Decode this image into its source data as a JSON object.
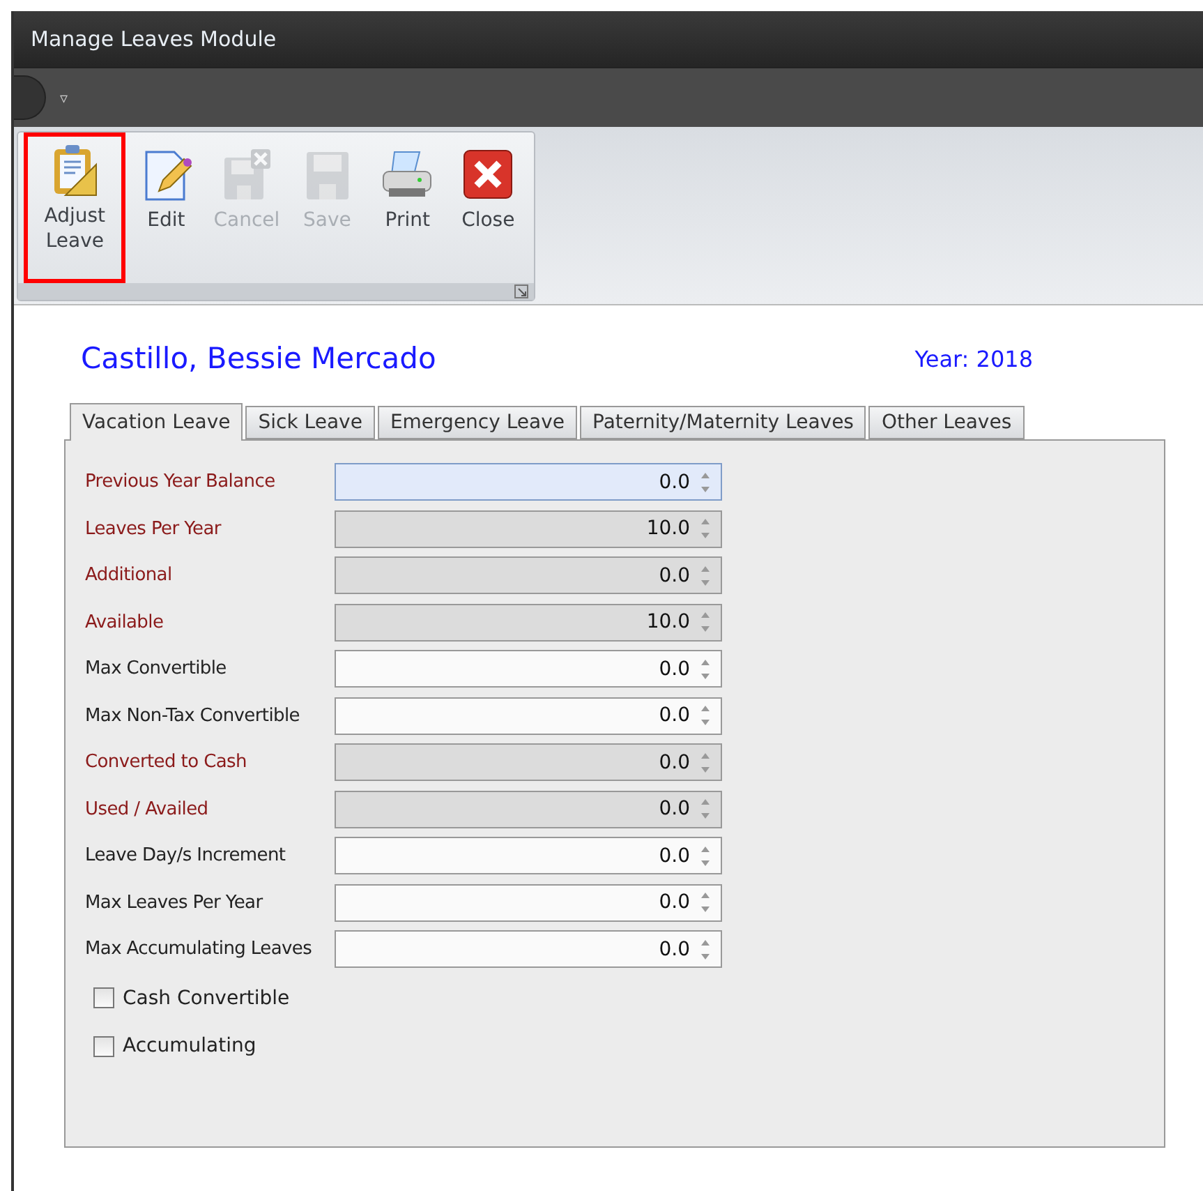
{
  "window": {
    "title": "Manage Leaves Module",
    "menu_glyph": "▿"
  },
  "toolbar": [
    {
      "label": "Adjust\nLeave",
      "kind": "adjust",
      "disabled": false,
      "highlighted": true
    },
    {
      "label": "Edit",
      "kind": "edit",
      "disabled": false,
      "highlighted": false
    },
    {
      "label": "Cancel",
      "kind": "cancel",
      "disabled": true,
      "highlighted": false
    },
    {
      "label": "Save",
      "kind": "save",
      "disabled": true,
      "highlighted": false
    },
    {
      "label": "Print",
      "kind": "print",
      "disabled": false,
      "highlighted": false
    },
    {
      "label": "Close",
      "kind": "close",
      "disabled": false,
      "highlighted": false
    }
  ],
  "employee": {
    "name": "Castillo, Bessie Mercado",
    "year": "Year: 2018"
  },
  "tabs": [
    {
      "label": "Vacation Leave",
      "selected": true
    },
    {
      "label": "Sick Leave",
      "selected": false
    },
    {
      "label": "Emergency Leave",
      "selected": false
    },
    {
      "label": "Paternity/Maternity Leaves",
      "selected": false
    },
    {
      "label": "Other Leaves",
      "selected": false
    }
  ],
  "fields": [
    {
      "label": "Previous Year Balance",
      "value": "0.0",
      "required": true,
      "readonly": false,
      "focused": true
    },
    {
      "label": "Leaves Per Year",
      "value": "10.0",
      "required": true,
      "readonly": true,
      "focused": false
    },
    {
      "label": "Additional",
      "value": "0.0",
      "required": true,
      "readonly": true,
      "focused": false
    },
    {
      "label": "Available",
      "value": "10.0",
      "required": true,
      "readonly": true,
      "focused": false
    },
    {
      "label": "Max Convertible",
      "value": "0.0",
      "required": false,
      "readonly": false,
      "focused": false
    },
    {
      "label": "Max Non-Tax Convertible",
      "value": "0.0",
      "required": false,
      "readonly": false,
      "focused": false
    },
    {
      "label": "Converted to Cash",
      "value": "0.0",
      "required": true,
      "readonly": true,
      "focused": false
    },
    {
      "label": "Used / Availed",
      "value": "0.0",
      "required": true,
      "readonly": true,
      "focused": false
    },
    {
      "label": "Leave Day/s Increment",
      "value": "0.0",
      "required": false,
      "readonly": false,
      "focused": false
    },
    {
      "label": "Max Leaves Per Year",
      "value": "0.0",
      "required": false,
      "readonly": false,
      "focused": false
    },
    {
      "label": "Max Accumulating Leaves",
      "value": "0.0",
      "required": false,
      "readonly": false,
      "focused": false
    }
  ],
  "checkboxes": [
    {
      "label": "Cash Convertible",
      "checked": false
    },
    {
      "label": "Accumulating",
      "checked": false
    }
  ]
}
